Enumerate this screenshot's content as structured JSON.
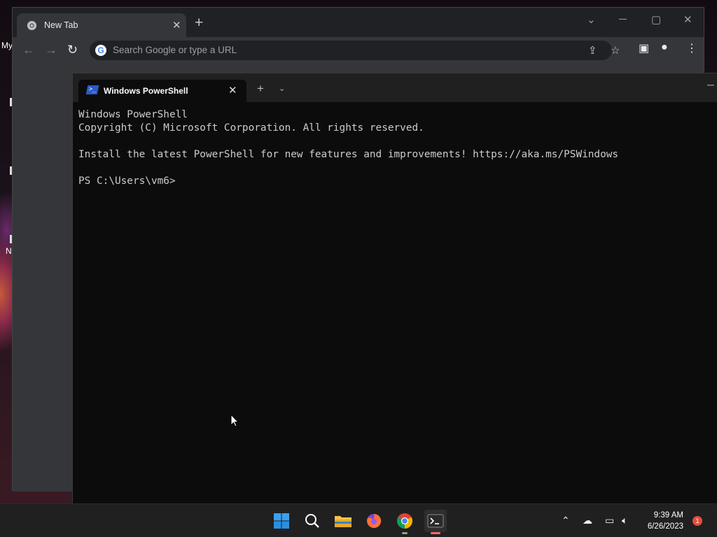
{
  "desktop": {
    "labels": [
      "My",
      "N"
    ]
  },
  "chrome": {
    "tab_title": "New Tab",
    "tab_close": "✕",
    "new_tab": "+",
    "omnibox_placeholder": "Search Google or type a URL",
    "google_letter": "G"
  },
  "terminal": {
    "tab_title": "Windows PowerShell",
    "tab_close": "✕",
    "new_tab": "+",
    "dropdown": "⌄",
    "lines": [
      "Windows PowerShell",
      "Copyright (C) Microsoft Corporation. All rights reserved.",
      "",
      "Install the latest PowerShell for new features and improvements! https://aka.ms/PSWindows",
      "",
      "PS C:\\Users\\vm6>"
    ]
  },
  "taskbar": {
    "apps": [
      "start-icon",
      "search-icon",
      "file-explorer-icon",
      "firefox-icon",
      "chrome-icon",
      "terminal-icon"
    ],
    "time": "9:39 AM",
    "date": "6/26/2023",
    "notification_count": "1"
  },
  "colors": {
    "chrome_dark": "#202124",
    "chrome_toolbar": "#35363a",
    "terminal_bg": "#0c0c0c",
    "taskbar_bg": "#202020",
    "terminal_indicator": "#ff6b6b"
  }
}
